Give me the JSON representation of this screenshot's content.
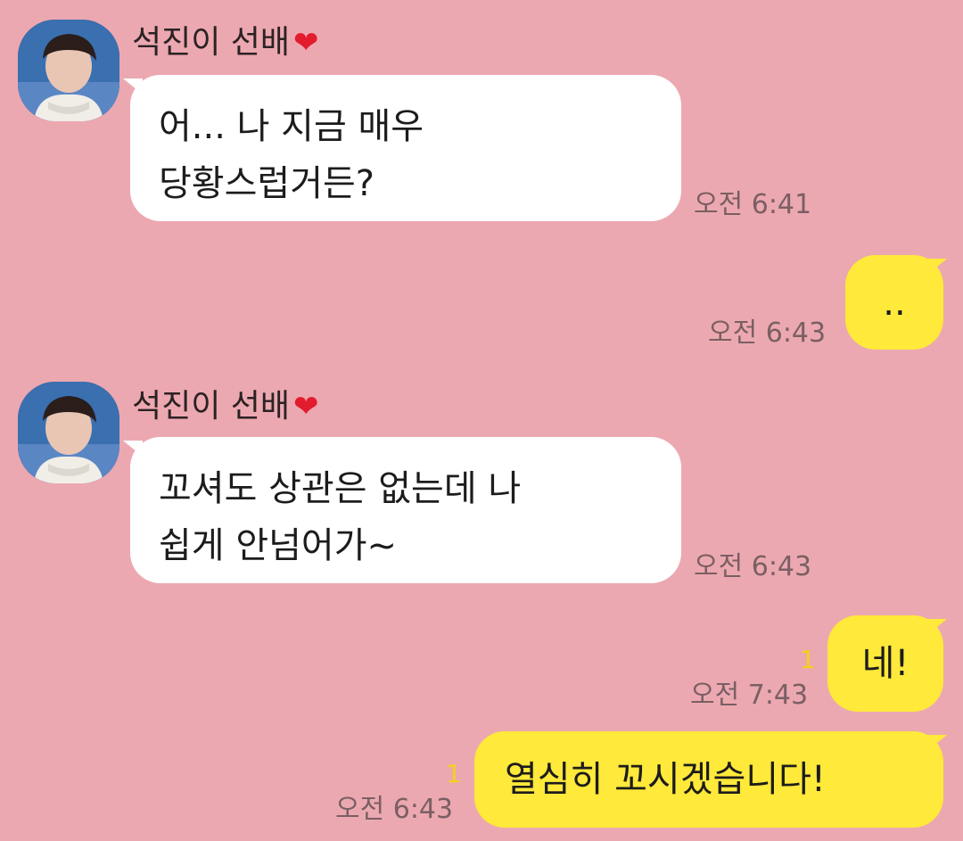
{
  "chat": {
    "messages": [
      {
        "direction": "incoming",
        "sender": "석진이 선배",
        "sender_emoji": "❤",
        "lines": [
          "어... 나 지금 매우",
          "당황스럽거든?"
        ],
        "time": "오전 6:41"
      },
      {
        "direction": "outgoing",
        "lines": [
          ".."
        ],
        "time": "오전 6:43"
      },
      {
        "direction": "incoming",
        "sender": "석진이 선배",
        "sender_emoji": "❤",
        "lines": [
          "꼬셔도 상관은 없는데 나",
          "쉽게 안넘어가~"
        ],
        "time": "오전 6:43"
      },
      {
        "direction": "outgoing",
        "lines": [
          "네!"
        ],
        "time": "오전 7:43",
        "unread": "1"
      },
      {
        "direction": "outgoing",
        "lines": [
          "열심히 꼬시겠습니다!"
        ],
        "time": "오전 6:43",
        "unread": "1"
      }
    ]
  },
  "colors": {
    "background": "#ECA8B0",
    "incoming_bubble": "#FFFFFF",
    "outgoing_bubble": "#FFE93A",
    "unread_count": "#F2D21B",
    "heart": "#E21B2D"
  },
  "icons": {
    "heart": "heart-emoji",
    "avatar": "profile-photo"
  }
}
